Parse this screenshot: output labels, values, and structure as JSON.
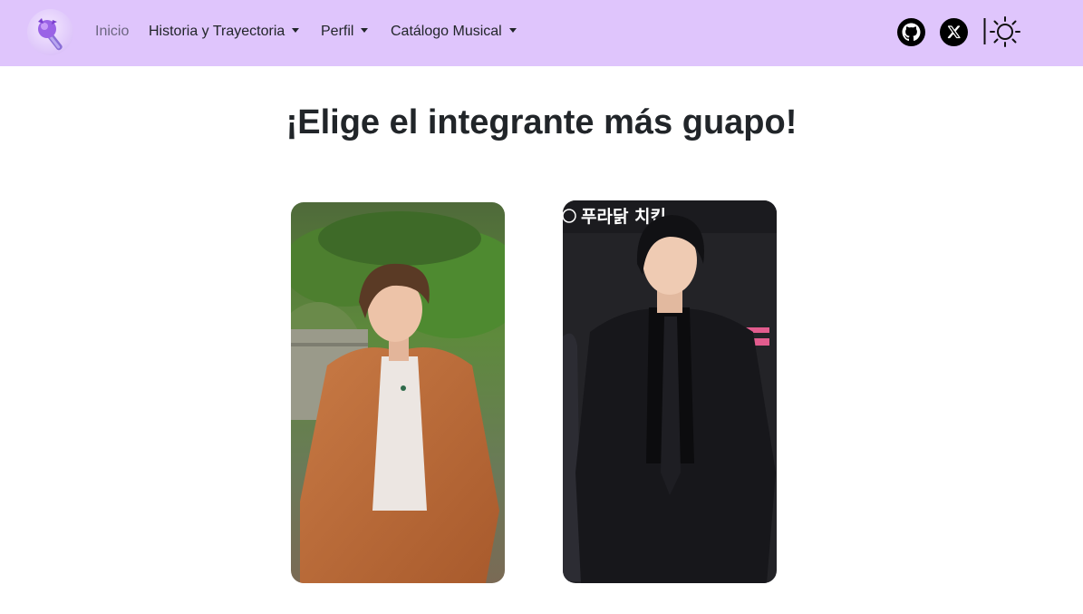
{
  "nav": {
    "brand_icon": "purple-lightstick-icon",
    "items": [
      {
        "label": "Inicio",
        "dropdown": false,
        "active": false
      },
      {
        "label": "Historia y Trayectoria",
        "dropdown": true
      },
      {
        "label": "Perfil",
        "dropdown": true
      },
      {
        "label": "Catálogo Musical",
        "dropdown": true
      }
    ],
    "social": [
      {
        "icon": "github-icon"
      },
      {
        "icon": "x-twitter-icon"
      }
    ],
    "theme_toggle_icon": "sun-icon"
  },
  "main": {
    "title": "¡Elige el integrante más guapo!",
    "cards": [
      {
        "image": "member-photo-brown-suit"
      },
      {
        "image": "member-photo-black-suit",
        "overlay_text": "푸라닭 치킨"
      }
    ]
  },
  "colors": {
    "navbar_bg": "#dfc5fc",
    "text": "#212529",
    "muted_link": "#6c6680",
    "page_bg": "#ffffff"
  }
}
